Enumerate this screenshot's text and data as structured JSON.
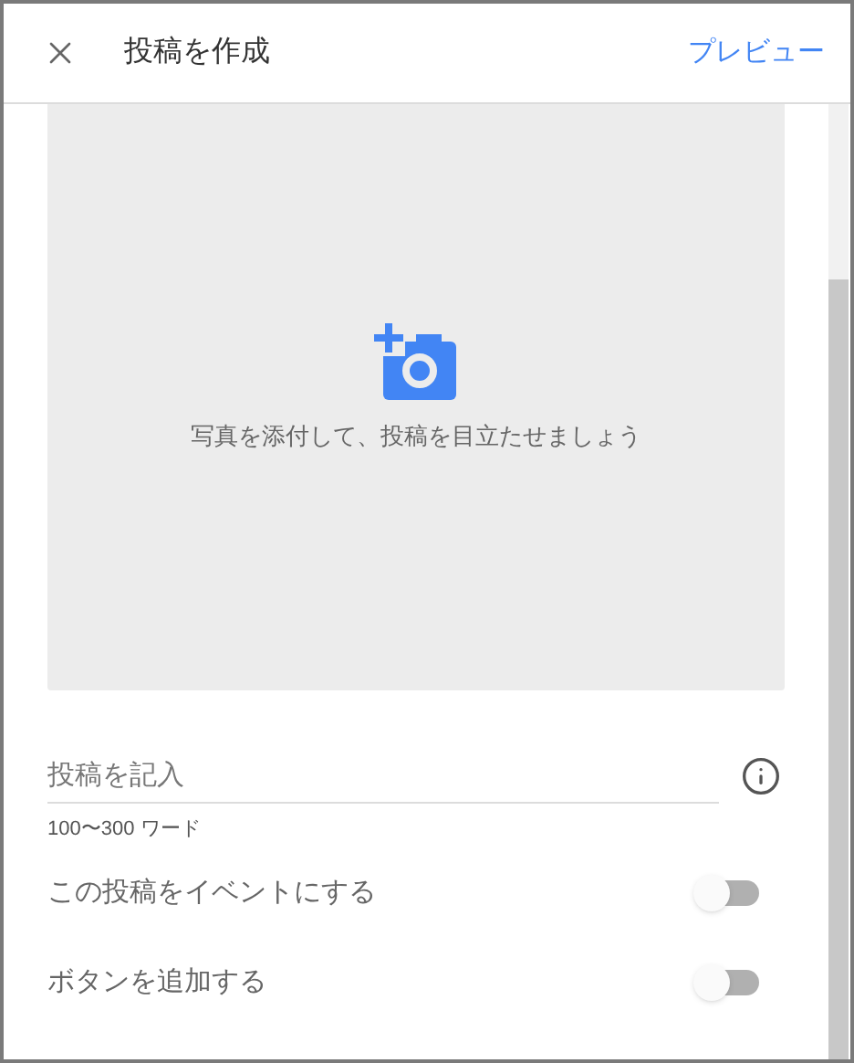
{
  "header": {
    "title": "投稿を作成",
    "action": "プレビュー"
  },
  "photo_upload": {
    "hint": "写真を添付して、投稿を目立たせましょう"
  },
  "post_field": {
    "placeholder": "投稿を記入",
    "helper": "100〜300 ワード"
  },
  "toggles": [
    {
      "label": "この投稿をイベントにする",
      "on": false
    },
    {
      "label": "ボタンを追加する",
      "on": false
    }
  ]
}
